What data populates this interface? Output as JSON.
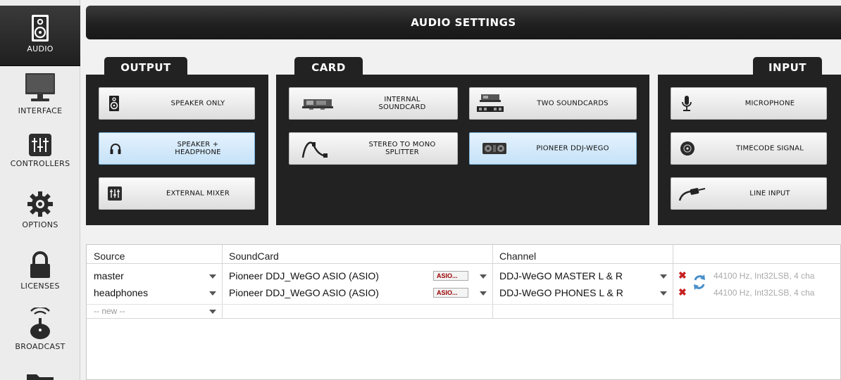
{
  "sidebar": {
    "items": [
      {
        "label": "AUDIO",
        "icon": "speaker-icon"
      },
      {
        "label": "INTERFACE",
        "icon": "monitor-icon"
      },
      {
        "label": "CONTROLLERS",
        "icon": "mixer-faders-icon"
      },
      {
        "label": "OPTIONS",
        "icon": "gear-icon"
      },
      {
        "label": "LICENSES",
        "icon": "padlock-icon"
      },
      {
        "label": "BROADCAST",
        "icon": "broadcast-icon"
      },
      {
        "label": "",
        "icon": "folder-icon"
      }
    ]
  },
  "header": {
    "title": "AUDIO SETTINGS"
  },
  "output": {
    "tab": "OUTPUT",
    "buttons": [
      "SPEAKER ONLY",
      "SPEAKER +\nHEADPHONE",
      "EXTERNAL MIXER"
    ]
  },
  "card": {
    "tab": "CARD",
    "buttons": [
      "INTERNAL\nSOUNDCARD",
      "TWO SOUNDCARDS",
      "STEREO TO MONO\nSPLITTER",
      "PIONEER DDJ-WEGO"
    ]
  },
  "input": {
    "tab": "INPUT",
    "buttons": [
      "MICROPHONE",
      "TIMECODE SIGNAL",
      "LINE INPUT"
    ]
  },
  "table": {
    "headers": [
      "Source",
      "SoundCard",
      "Channel"
    ],
    "rows": [
      {
        "source": "master",
        "soundcard": "Pioneer DDJ_WeGO ASIO (ASIO)",
        "asio": "ASIO...",
        "channel": "DDJ-WeGO MASTER L & R",
        "info": "44100 Hz, Int32LSB, 4 cha"
      },
      {
        "source": "headphones",
        "soundcard": "Pioneer DDJ_WeGO ASIO (ASIO)",
        "asio": "ASIO...",
        "channel": "DDJ-WeGO PHONES L & R",
        "info": "44100 Hz, Int32LSB, 4 cha"
      }
    ],
    "new_row": "-- new --"
  },
  "colors": {
    "accent_selected": "#c6e2f8",
    "panel": "#222222",
    "remove": "#c62222"
  }
}
